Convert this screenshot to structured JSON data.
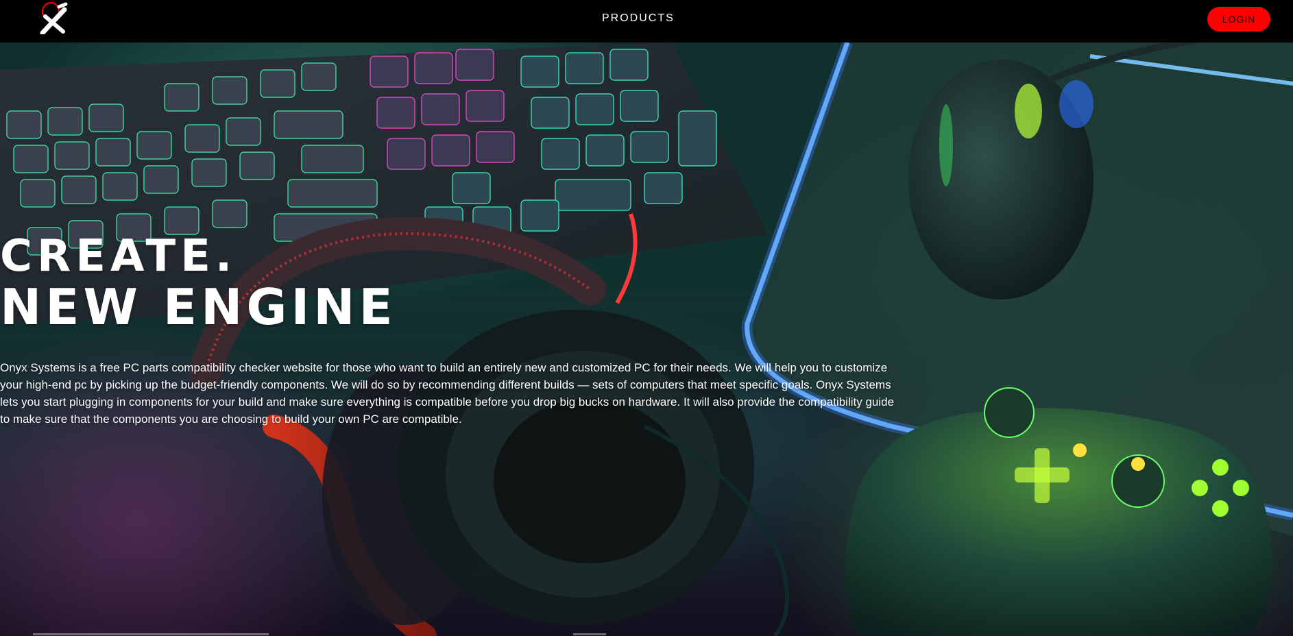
{
  "nav": {
    "logo_name": "onyx-logo",
    "products_label": "PRODUCTS",
    "login_label": "LOGIN",
    "accent_color": "#ff0000"
  },
  "hero": {
    "headline_line1": "CREATE.",
    "headline_line2": "NEW ENGINE",
    "description": "Onyx Systems is a free PC parts compatibility checker website for those who want to build an entirely new and customized PC for their needs. We will help you to customize your high-end pc by picking up the budget-friendly components. We will do so by recommending different builds — sets of computers that meet specific goals. Onyx Systems lets you start plugging in components for your build and make sure everything is compatible before you drop big bucks on hardware. It will also provide the compatibility guide to make sure that the components you are choosing to build your own PC are compatible.",
    "background_scene": "gaming-desk-photo"
  }
}
